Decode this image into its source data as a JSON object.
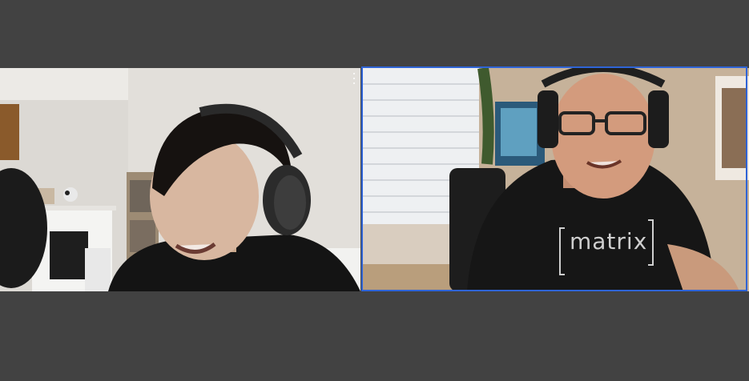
{
  "call": {
    "participants": [
      {
        "id": "left"
      },
      {
        "id": "right",
        "active_speaker": true,
        "shirt_text": "[matrix]"
      }
    ]
  },
  "colors": {
    "background": "#424242",
    "active_speaker_border": "#2f64d6"
  }
}
